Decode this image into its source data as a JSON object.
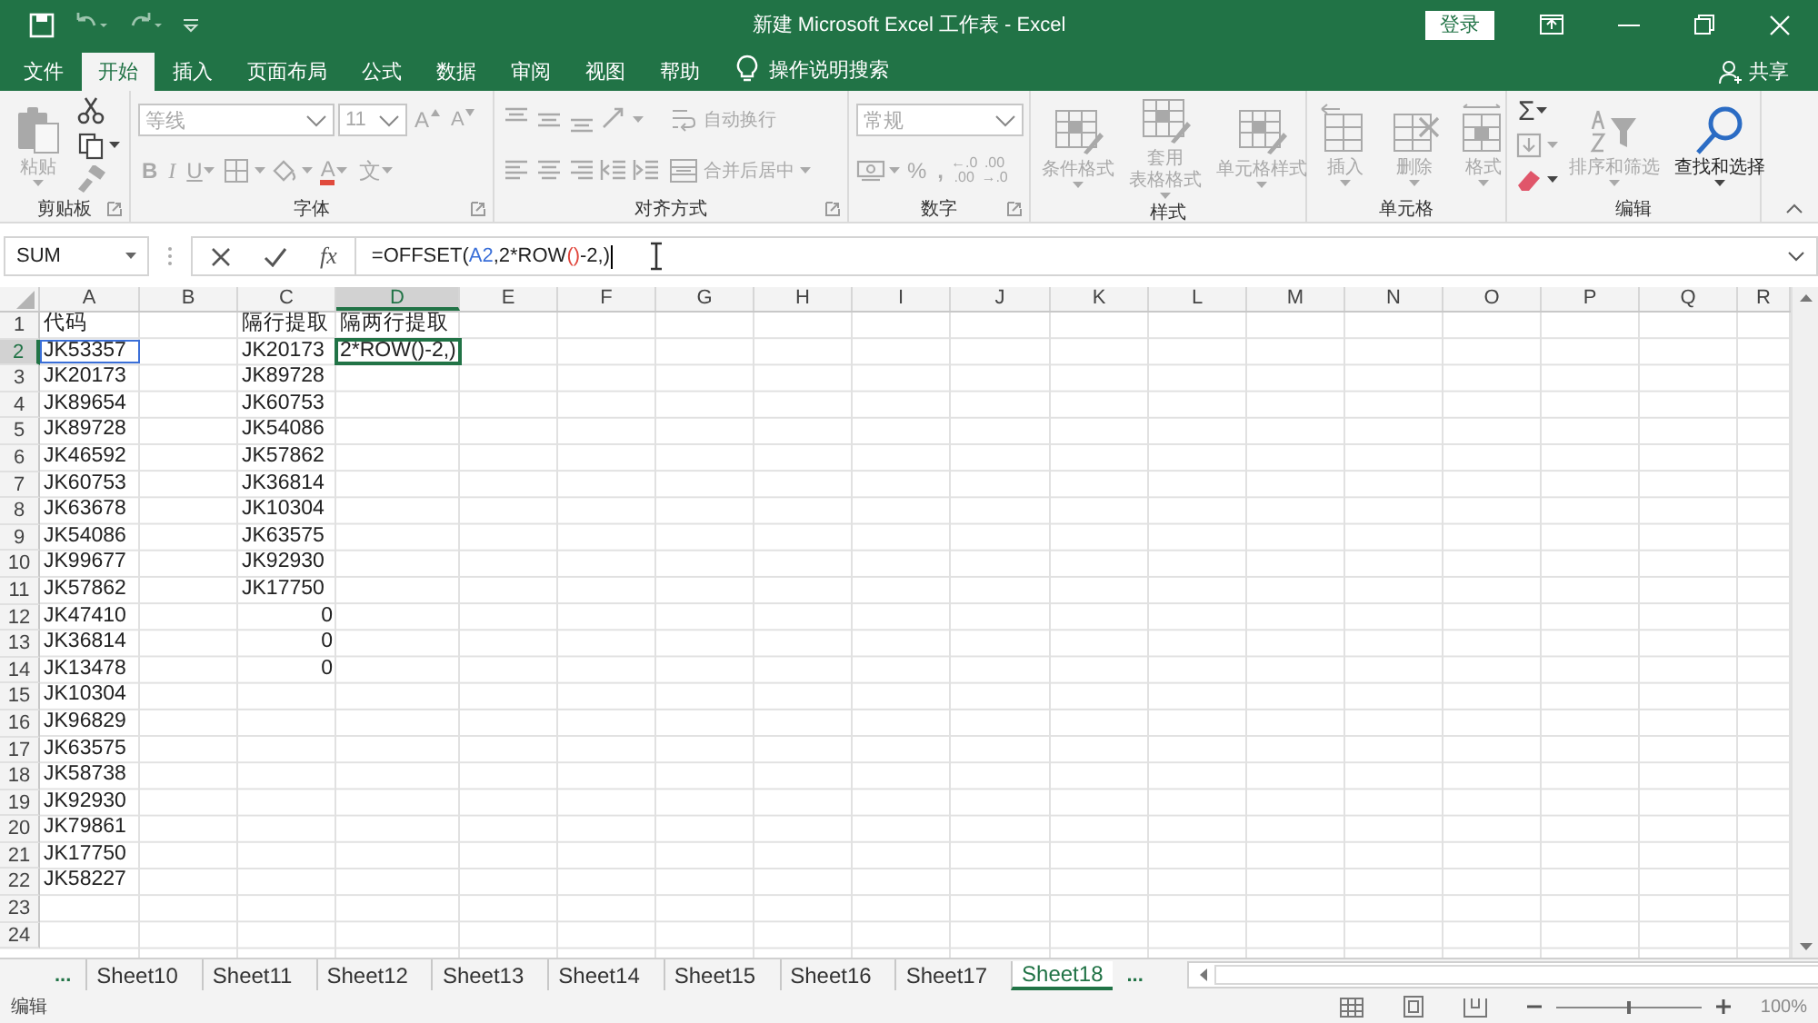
{
  "window": {
    "title": "新建 Microsoft Excel 工作表 - Excel",
    "sign_in": "登录"
  },
  "tabs": [
    {
      "label": "文件",
      "selected": false
    },
    {
      "label": "开始",
      "selected": true
    },
    {
      "label": "插入",
      "selected": false
    },
    {
      "label": "页面布局",
      "selected": false
    },
    {
      "label": "公式",
      "selected": false
    },
    {
      "label": "数据",
      "selected": false
    },
    {
      "label": "审阅",
      "selected": false
    },
    {
      "label": "视图",
      "selected": false
    },
    {
      "label": "帮助",
      "selected": false
    }
  ],
  "tell_me": "操作说明搜索",
  "share": "共享",
  "ribbon": [
    {
      "label": "剪贴板",
      "launcher": true,
      "columns": [
        [
          [
            {
              "kind": "paste",
              "lines": [
                "粘贴"
              ],
              "disabled": true
            }
          ]
        ],
        [
          [
            {
              "kind": "cut",
              "disabled": false
            }
          ],
          [
            {
              "kind": "copy",
              "disabled": false
            }
          ],
          [
            {
              "kind": "painter",
              "disabled": true
            }
          ]
        ]
      ]
    },
    {
      "label": "字体",
      "launcher": true,
      "columns": [
        [
          [
            {
              "kind": "font",
              "value": "等线",
              "disabled": true
            },
            {
              "kind": "size",
              "value": "11",
              "disabled": true
            },
            {
              "kind": "grow",
              "label": "A",
              "disabled": true
            },
            {
              "kind": "shrink",
              "label": "A",
              "disabled": true
            }
          ],
          [
            {
              "kind": "bold",
              "label": "B",
              "disabled": true
            },
            {
              "kind": "italic",
              "label": "I",
              "disabled": true
            },
            {
              "kind": "underline",
              "label": "U",
              "disabled": true
            },
            {
              "kind": "border",
              "disabled": true
            },
            {
              "kind": "fill",
              "disabled": true
            },
            {
              "kind": "fontcolor",
              "label": "A",
              "disabled": true
            },
            {
              "kind": "phonetic",
              "label": "文",
              "disabled": true
            }
          ]
        ]
      ]
    },
    {
      "label": "对齐方式",
      "launcher": true,
      "columns": [
        [
          [
            {
              "kind": "top",
              "disabled": true
            },
            {
              "kind": "middle",
              "disabled": true
            },
            {
              "kind": "bottom",
              "disabled": true
            },
            {
              "kind": "orientation",
              "disabled": true
            }
          ],
          [
            {
              "kind": "left",
              "disabled": true
            },
            {
              "kind": "center",
              "disabled": true
            },
            {
              "kind": "right",
              "disabled": true
            },
            {
              "kind": "outdent",
              "disabled": true
            },
            {
              "kind": "indent",
              "disabled": true
            }
          ]
        ],
        [
          [
            {
              "kind": "wrap",
              "label": "自动换行",
              "disabled": true
            }
          ],
          [
            {
              "kind": "merge",
              "label": "合并后居中",
              "disabled": true
            }
          ]
        ]
      ]
    },
    {
      "label": "数字",
      "launcher": true,
      "columns": [
        [
          [
            {
              "kind": "numfmt",
              "value": "常规",
              "disabled": true
            }
          ],
          [
            {
              "kind": "currency",
              "disabled": true
            },
            {
              "kind": "percent",
              "label": "%",
              "disabled": true
            },
            {
              "kind": "comma",
              "label": ",",
              "disabled": true
            },
            {
              "kind": "incdec",
              "lines": [
                "←.0",
                ".00"
              ],
              "disabled": true
            },
            {
              "kind": "decdec",
              "lines": [
                ".00",
                "→.0"
              ],
              "disabled": true
            }
          ]
        ]
      ]
    },
    {
      "label": "样式",
      "launcher": false,
      "columns": [
        [
          [
            {
              "kind": "condfmt",
              "lines": [
                "条件格式"
              ],
              "disabled": true
            }
          ]
        ],
        [
          [
            {
              "kind": "tablefmt",
              "lines": [
                "套用",
                "表格格式"
              ],
              "disabled": true
            }
          ]
        ],
        [
          [
            {
              "kind": "cellstyle",
              "lines": [
                "单元格样式"
              ],
              "disabled": true
            }
          ]
        ]
      ]
    },
    {
      "label": "单元格",
      "launcher": false,
      "columns": [
        [
          [
            {
              "kind": "insert",
              "lines": [
                "插入"
              ],
              "disabled": true
            }
          ]
        ],
        [
          [
            {
              "kind": "delete",
              "lines": [
                "删除"
              ],
              "disabled": true
            }
          ]
        ],
        [
          [
            {
              "kind": "format",
              "lines": [
                "格式"
              ],
              "disabled": true
            }
          ]
        ]
      ]
    },
    {
      "label": "编辑",
      "launcher": false,
      "columns": [
        [
          [
            {
              "kind": "sum",
              "label": "Σ",
              "disabled": false
            }
          ],
          [
            {
              "kind": "filldown",
              "disabled": true
            }
          ],
          [
            {
              "kind": "clear",
              "disabled": false
            }
          ]
        ],
        [
          [
            {
              "kind": "sort",
              "lines": [
                "排序和筛选"
              ],
              "disabled": true
            }
          ]
        ],
        [
          [
            {
              "kind": "find",
              "lines": [
                "查找和选择"
              ],
              "disabled": false
            }
          ]
        ]
      ]
    }
  ],
  "formula_bar": {
    "name_box": "SUM",
    "function_label": "fx",
    "segments": [
      {
        "text": "=OFFSET("
      },
      {
        "text": "A2",
        "color": "#3a6fd8"
      },
      {
        "text": ",2*ROW"
      },
      {
        "text": "()",
        "color": "#e0463c"
      },
      {
        "text": "-2,)"
      }
    ]
  },
  "sheet": {
    "columns": [
      {
        "label": "A",
        "selected": false
      },
      {
        "label": "B",
        "selected": false
      },
      {
        "label": "C",
        "selected": false
      },
      {
        "label": "D",
        "selected": true
      },
      {
        "label": "E",
        "selected": false
      },
      {
        "label": "F",
        "selected": false
      },
      {
        "label": "G",
        "selected": false
      },
      {
        "label": "H",
        "selected": false
      },
      {
        "label": "I",
        "selected": false
      },
      {
        "label": "J",
        "selected": false
      },
      {
        "label": "K",
        "selected": false
      },
      {
        "label": "L",
        "selected": false
      },
      {
        "label": "M",
        "selected": false
      },
      {
        "label": "N",
        "selected": false
      },
      {
        "label": "O",
        "selected": false
      },
      {
        "label": "P",
        "selected": false
      },
      {
        "label": "Q",
        "selected": false
      },
      {
        "label": "R",
        "selected": false
      }
    ],
    "rows": [
      {
        "label": "1",
        "selected": false,
        "cells": {
          "A": {
            "text": "代码",
            "kind": "text"
          },
          "C": {
            "text": "隔行提取",
            "kind": "text"
          },
          "D": {
            "text": "隔两行提取",
            "kind": "text"
          }
        }
      },
      {
        "label": "2",
        "selected": true,
        "cells": {
          "A": {
            "text": "JK53357",
            "kind": "reference"
          },
          "C": {
            "text": "JK20173",
            "kind": "text"
          },
          "D": {
            "text": "2*ROW()-2,)",
            "kind": "editing"
          }
        }
      },
      {
        "label": "3",
        "selected": false,
        "cells": {
          "A": {
            "text": "JK20173",
            "kind": "text"
          },
          "C": {
            "text": "JK89728",
            "kind": "text"
          }
        }
      },
      {
        "label": "4",
        "selected": false,
        "cells": {
          "A": {
            "text": "JK89654",
            "kind": "text"
          },
          "C": {
            "text": "JK60753",
            "kind": "text"
          }
        }
      },
      {
        "label": "5",
        "selected": false,
        "cells": {
          "A": {
            "text": "JK89728",
            "kind": "text"
          },
          "C": {
            "text": "JK54086",
            "kind": "text"
          }
        }
      },
      {
        "label": "6",
        "selected": false,
        "cells": {
          "A": {
            "text": "JK46592",
            "kind": "text"
          },
          "C": {
            "text": "JK57862",
            "kind": "text"
          }
        }
      },
      {
        "label": "7",
        "selected": false,
        "cells": {
          "A": {
            "text": "JK60753",
            "kind": "text"
          },
          "C": {
            "text": "JK36814",
            "kind": "text"
          }
        }
      },
      {
        "label": "8",
        "selected": false,
        "cells": {
          "A": {
            "text": "JK63678",
            "kind": "text"
          },
          "C": {
            "text": "JK10304",
            "kind": "text"
          }
        }
      },
      {
        "label": "9",
        "selected": false,
        "cells": {
          "A": {
            "text": "JK54086",
            "kind": "text"
          },
          "C": {
            "text": "JK63575",
            "kind": "text"
          }
        }
      },
      {
        "label": "10",
        "selected": false,
        "cells": {
          "A": {
            "text": "JK99677",
            "kind": "text"
          },
          "C": {
            "text": "JK92930",
            "kind": "text"
          }
        }
      },
      {
        "label": "11",
        "selected": false,
        "cells": {
          "A": {
            "text": "JK57862",
            "kind": "text"
          },
          "C": {
            "text": "JK17750",
            "kind": "text"
          }
        }
      },
      {
        "label": "12",
        "selected": false,
        "cells": {
          "A": {
            "text": "JK47410",
            "kind": "text"
          },
          "C": {
            "text": "0",
            "kind": "number"
          }
        }
      },
      {
        "label": "13",
        "selected": false,
        "cells": {
          "A": {
            "text": "JK36814",
            "kind": "text"
          },
          "C": {
            "text": "0",
            "kind": "number"
          }
        }
      },
      {
        "label": "14",
        "selected": false,
        "cells": {
          "A": {
            "text": "JK13478",
            "kind": "text"
          },
          "C": {
            "text": "0",
            "kind": "number"
          }
        }
      },
      {
        "label": "15",
        "selected": false,
        "cells": {
          "A": {
            "text": "JK10304",
            "kind": "text"
          }
        }
      },
      {
        "label": "16",
        "selected": false,
        "cells": {
          "A": {
            "text": "JK96829",
            "kind": "text"
          }
        }
      },
      {
        "label": "17",
        "selected": false,
        "cells": {
          "A": {
            "text": "JK63575",
            "kind": "text"
          }
        }
      },
      {
        "label": "18",
        "selected": false,
        "cells": {
          "A": {
            "text": "JK58738",
            "kind": "text"
          }
        }
      },
      {
        "label": "19",
        "selected": false,
        "cells": {
          "A": {
            "text": "JK92930",
            "kind": "text"
          }
        }
      },
      {
        "label": "20",
        "selected": false,
        "cells": {
          "A": {
            "text": "JK79861",
            "kind": "text"
          }
        }
      },
      {
        "label": "21",
        "selected": false,
        "cells": {
          "A": {
            "text": "JK17750",
            "kind": "text"
          }
        }
      },
      {
        "label": "22",
        "selected": false,
        "cells": {
          "A": {
            "text": "JK58227",
            "kind": "text"
          }
        }
      },
      {
        "label": "23",
        "selected": false,
        "cells": {}
      },
      {
        "label": "24",
        "selected": false,
        "cells": {}
      }
    ]
  },
  "sheet_tabs": {
    "more_left": "...",
    "more_right": "...",
    "items": [
      {
        "label": "Sheet10",
        "selected": false
      },
      {
        "label": "Sheet11",
        "selected": false
      },
      {
        "label": "Sheet12",
        "selected": false
      },
      {
        "label": "Sheet13",
        "selected": false
      },
      {
        "label": "Sheet14",
        "selected": false
      },
      {
        "label": "Sheet15",
        "selected": false
      },
      {
        "label": "Sheet16",
        "selected": false
      },
      {
        "label": "Sheet17",
        "selected": false
      },
      {
        "label": "Sheet18",
        "selected": true
      }
    ]
  },
  "status_bar": {
    "mode": "编辑",
    "zoom": "100%",
    "zoom_slider": {
      "level": 0.5
    }
  }
}
